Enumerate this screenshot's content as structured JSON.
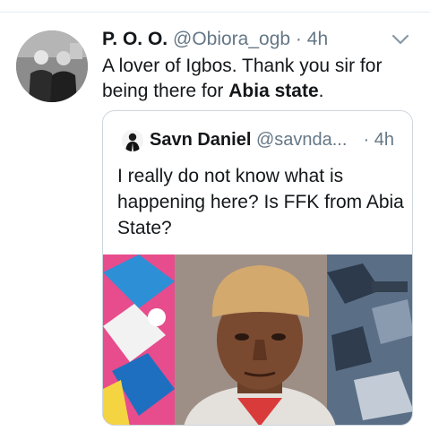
{
  "tweet": {
    "display_name": "P. O. O.",
    "handle": "@Obiora_ogb",
    "separator": "·",
    "time": "4h",
    "text_before": "A lover of Igbos. Thank you sir for being there for ",
    "text_bold": "Abia state",
    "text_after": "."
  },
  "quoted_tweet": {
    "display_name": "Savn Daniel",
    "handle": "@savnda...",
    "time": "· 4h",
    "text": "I really do not know what is happening here? Is FFK from Abia State?"
  },
  "icons": {
    "avatar": "profile-photo",
    "caret": "chevron-down-icon",
    "quoted_avatar": "profile-photo"
  },
  "colors": {
    "text": "#14171a",
    "secondary": "#657786",
    "border": "#ccd6dd"
  }
}
